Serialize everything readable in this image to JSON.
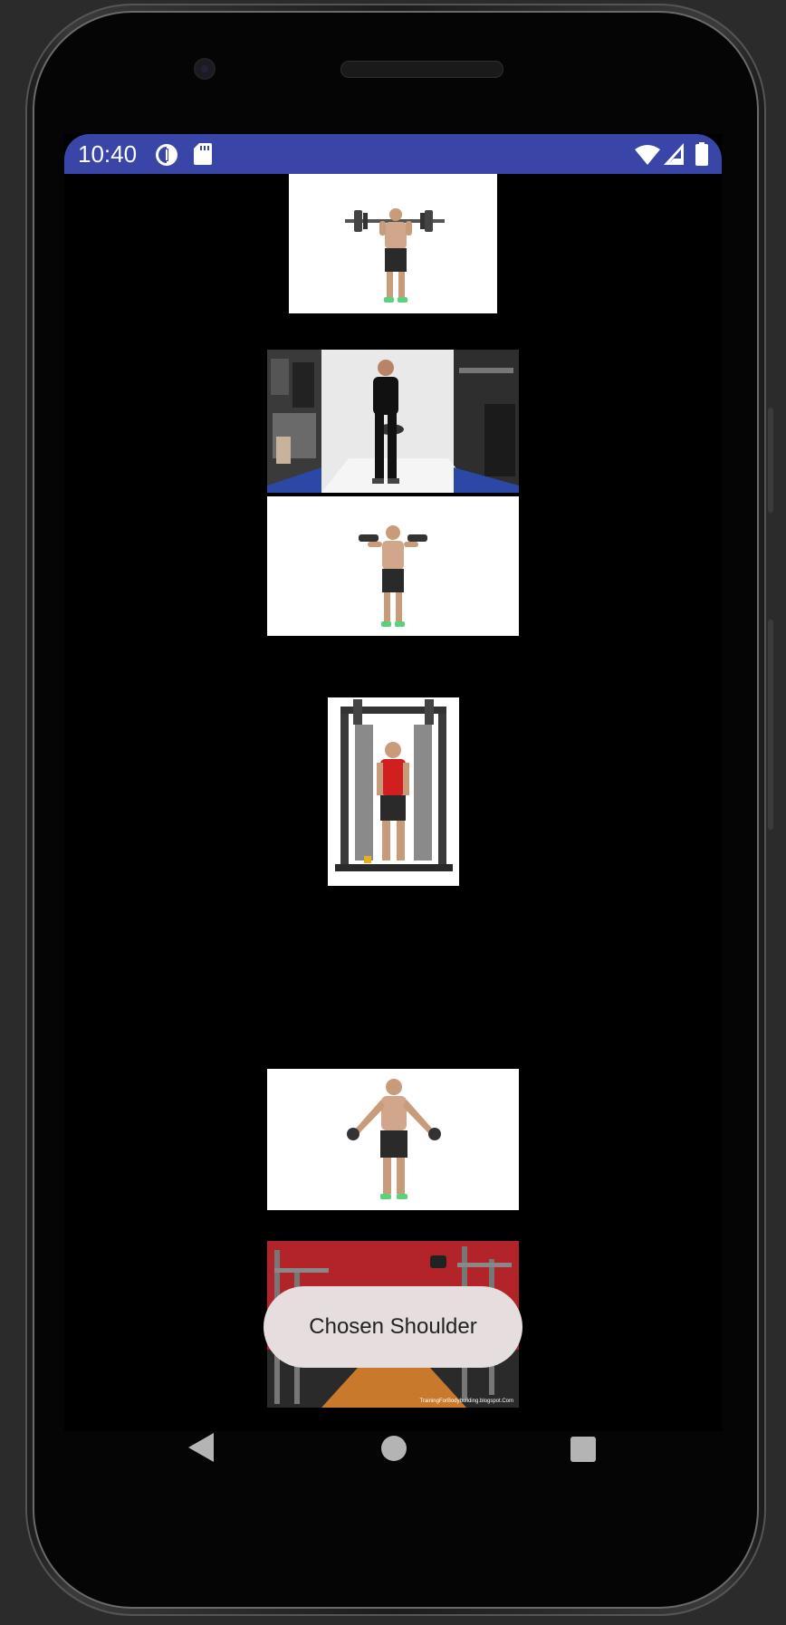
{
  "status_bar": {
    "time": "10:40",
    "left_icons": [
      "data-saver-icon",
      "sd-card-icon"
    ],
    "right_icons": [
      "wifi-icon",
      "signal-icon",
      "battery-icon"
    ],
    "color": "#3a45a8"
  },
  "exercise_images": [
    {
      "name": "barbell-front-raise-image",
      "background": "#ffffff"
    },
    {
      "name": "plate-raise-gym-image",
      "background": "#e9e9e9"
    },
    {
      "name": "dumbbell-shoulder-press-image",
      "background": "#ffffff"
    },
    {
      "name": "cable-machine-row-image",
      "background": "#ffffff"
    },
    {
      "name": "dumbbell-lateral-raise-image",
      "background": "#ffffff"
    },
    {
      "name": "dumbbell-front-raise-gym-image",
      "background": "#b3232a",
      "watermark": "TrainingForBodybuilding.blogspot.Com"
    }
  ],
  "toast": {
    "message": "Chosen Shoulder"
  },
  "navigation_bar": {
    "icons": [
      "back-icon",
      "home-icon",
      "recents-icon"
    ]
  }
}
